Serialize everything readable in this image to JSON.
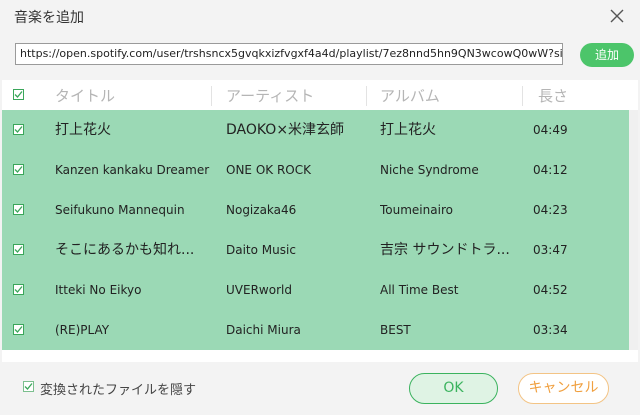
{
  "window": {
    "title": "音楽を追加"
  },
  "url_input": {
    "value": "https://open.spotify.com/user/trshsncx5gvqkxizfvgxf4a4d/playlist/7ez8nnd5hn9QN3wcowQ0wW?si="
  },
  "add_button": {
    "label": "追加"
  },
  "columns": {
    "title": "タイトル",
    "artist": "アーティスト",
    "album": "アルバム",
    "length": "長さ"
  },
  "tracks": [
    {
      "title": "打上花火",
      "artist": "DAOKO×米津玄師",
      "album": "打上花火",
      "length": "04:49"
    },
    {
      "title": "Kanzen kankaku Dreamer",
      "artist": "ONE OK ROCK",
      "album": "Niche Syndrome",
      "length": "04:12"
    },
    {
      "title": "Seifukuno Mannequin",
      "artist": "Nogizaka46",
      "album": "Toumeinairo",
      "length": "04:23"
    },
    {
      "title": "そこにあるかも知れ...",
      "artist": "Daito Music",
      "album": "吉宗 サウンドトラ...",
      "length": "03:47"
    },
    {
      "title": "Itteki No Eikyo",
      "artist": "UVERworld",
      "album": "All Time Best",
      "length": "04:52"
    },
    {
      "title": "(RE)PLAY",
      "artist": "Daichi Miura",
      "album": "BEST",
      "length": "03:34"
    }
  ],
  "footer": {
    "hide_converted_label": "変換されたファイルを隠す",
    "ok_label": "OK",
    "cancel_label": "キャンセル"
  },
  "colors": {
    "accent_green": "#4cc56a",
    "row_highlight": "#9bd9b5",
    "cancel_orange": "#f0a040"
  }
}
